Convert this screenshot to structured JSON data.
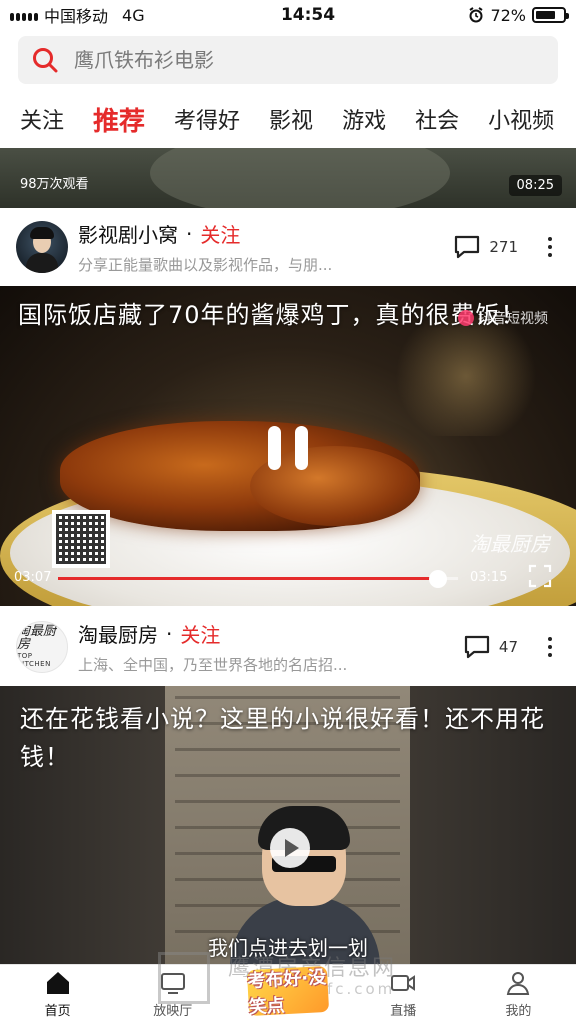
{
  "status_bar": {
    "carrier": "中国移动",
    "network": "4G",
    "time": "14:54",
    "battery": "72%",
    "battery_level": 0.72
  },
  "search": {
    "placeholder": "鹰爪铁布衫电影"
  },
  "tabs": [
    {
      "label": "关注",
      "active": false
    },
    {
      "label": "推荐",
      "active": true
    },
    {
      "label": "考得好",
      "active": false
    },
    {
      "label": "影视",
      "active": false
    },
    {
      "label": "游戏",
      "active": false
    },
    {
      "label": "社会",
      "active": false
    },
    {
      "label": "小视频",
      "active": false
    }
  ],
  "top_video": {
    "views": "98万次观看",
    "duration": "08:25"
  },
  "post1": {
    "author": "影视剧小窝",
    "separator": "·",
    "follow": "关注",
    "desc": "分享正能量歌曲以及影视作品，与朋...",
    "comments": "271",
    "title": "国际饭店藏了70年的酱爆鸡丁，真的很费饭！",
    "watermark_top": "抖音短视频",
    "watermark_logo": "淘最厨房",
    "time_current": "03:07",
    "time_total": "03:15",
    "progress": 0.95
  },
  "post2": {
    "author": "淘最厨房",
    "separator": "·",
    "follow": "关注",
    "avatar_logo_cn": "淘最厨房",
    "avatar_logo_en": "TOP KITCHEN",
    "desc": "上海、全中国，乃至世界各地的名店招...",
    "comments": "47",
    "title": "还在花钱看小说？这里的小说很好看！还不用花钱！",
    "subtitle": "我们点进去划一划"
  },
  "bottom_nav": [
    {
      "label": "首页",
      "icon": "home-icon",
      "active": true
    },
    {
      "label": "放映厅",
      "icon": "screen-icon",
      "active": false
    },
    {
      "label": "",
      "icon": "center-logo",
      "active": false
    },
    {
      "label": "直播",
      "icon": "live-icon",
      "active": false
    },
    {
      "label": "我的",
      "icon": "profile-icon",
      "active": false
    }
  ],
  "center_logo_text": "考布好·没笑点",
  "site_watermark": {
    "name": "鹰潭房产信息网",
    "url": "www.ytfc.com"
  },
  "colors": {
    "accent": "#e52b2b",
    "text": "#222222",
    "muted": "#999999"
  }
}
